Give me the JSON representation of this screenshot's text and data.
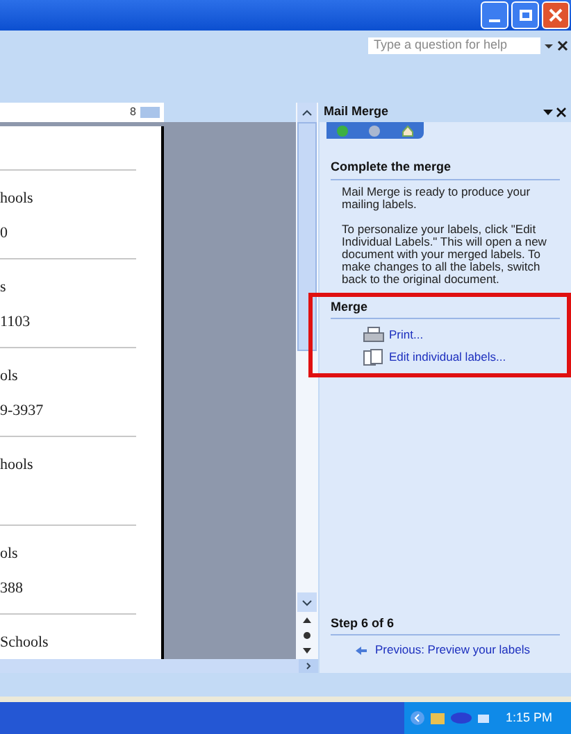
{
  "help": {
    "placeholder": "Type a question for help"
  },
  "ruler": {
    "label": "8"
  },
  "labels": [
    {
      "lines": [
        "hools",
        "0"
      ]
    },
    {
      "lines": [
        "s",
        "1103"
      ]
    },
    {
      "lines": [
        "ols",
        "9-3937"
      ]
    },
    {
      "lines": [
        "hools"
      ]
    },
    {
      "lines": [
        "ols",
        "388"
      ]
    },
    {
      "lines": [
        "Schools"
      ]
    }
  ],
  "task_pane": {
    "title": "Mail Merge",
    "heading": "Complete the merge",
    "paragraphs": [
      "Mail Merge is ready to produce your mailing labels.",
      "To personalize your labels, click \"Edit Individual Labels.\" This will open a new document with your merged labels. To make changes to all the labels, switch back to the original document."
    ],
    "merge_heading": "Merge",
    "actions": [
      {
        "kind": "print",
        "label": "Print..."
      },
      {
        "kind": "edit",
        "label": "Edit individual labels..."
      }
    ],
    "step": "Step 6 of 6",
    "previous": "Previous: Preview your labels"
  },
  "clock": "1:15 PM"
}
